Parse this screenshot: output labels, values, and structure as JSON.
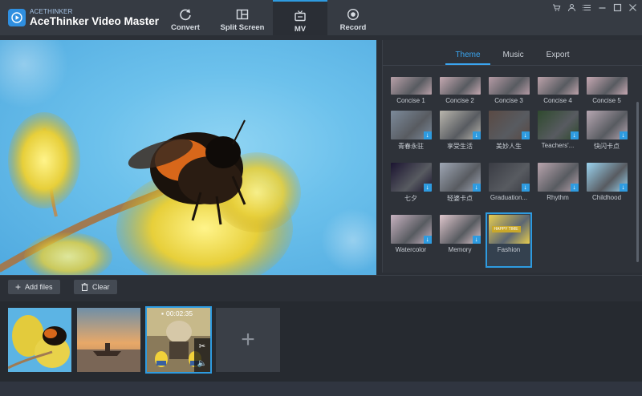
{
  "app": {
    "brand_small": "ACETHINKER",
    "title": "AceThinker Video Master"
  },
  "nav": {
    "convert": "Convert",
    "split_screen": "Split Screen",
    "mv": "MV",
    "record": "Record"
  },
  "window_controls": [
    "cart-icon",
    "user-icon",
    "menu-icon",
    "minimize-icon",
    "maximize-icon",
    "close-icon"
  ],
  "panel": {
    "tabs": [
      "Theme",
      "Music",
      "Export"
    ],
    "active_tab": "Theme",
    "themes": [
      {
        "label": "Concise 1",
        "color": "#b8a0a8",
        "download": false
      },
      {
        "label": "Concise 2",
        "color": "#c4a8b0",
        "download": false
      },
      {
        "label": "Concise 3",
        "color": "#b49aa4",
        "download": false
      },
      {
        "label": "Concise 4",
        "color": "#bca2aa",
        "download": false
      },
      {
        "label": "Concise 5",
        "color": "#c6a8b2",
        "download": false
      },
      {
        "label": "青春永驻",
        "color": "#7c8a9a",
        "download": true
      },
      {
        "label": "享受生活",
        "color": "#b9b6ad",
        "download": true
      },
      {
        "label": "美妙人生",
        "color": "#5a4a44",
        "download": true
      },
      {
        "label": "Teachers'...",
        "color": "#2f4a2e",
        "download": true
      },
      {
        "label": "快闪卡点",
        "color": "#b7a7b2",
        "download": true
      },
      {
        "label": "七夕",
        "color": "#1b1430",
        "download": true
      },
      {
        "label": "轻婆卡点",
        "color": "#9ea6b4",
        "download": true
      },
      {
        "label": "Graduation...",
        "color": "#3a3c44",
        "download": true
      },
      {
        "label": "Rhythm",
        "color": "#b8a4ad",
        "download": true
      },
      {
        "label": "Childhood",
        "color": "#9ad3ef",
        "download": true
      },
      {
        "label": "Watercolor",
        "color": "#c7b2c0",
        "download": true
      },
      {
        "label": "Memory",
        "color": "#dfc6cc",
        "download": true
      },
      {
        "label": "Fashion",
        "color": "#e8cd4f",
        "download": false,
        "selected": true,
        "caption": "HAPPY TIME"
      }
    ]
  },
  "actions": {
    "add_files": "Add files",
    "clear": "Clear"
  },
  "timeline": {
    "clip3_duration": "00:02:35"
  },
  "colors": {
    "accent": "#2e9be0",
    "background": "#2b2f36"
  }
}
